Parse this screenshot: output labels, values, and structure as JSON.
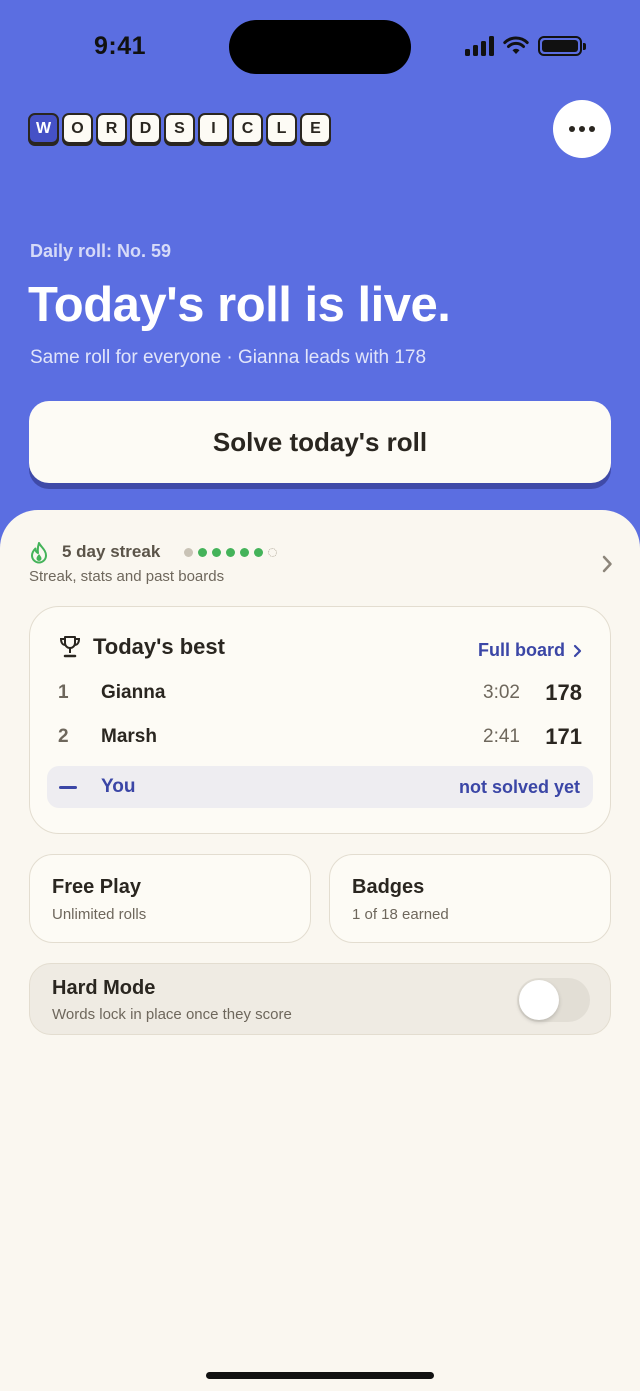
{
  "status_bar": {
    "time": "9:41"
  },
  "header": {
    "logo_letters": [
      "W",
      "O",
      "R",
      "D",
      "S",
      "I",
      "C",
      "L",
      "E"
    ],
    "menu_icon": "more-horizontal-icon"
  },
  "hero": {
    "daily_label": "Daily roll: No. 59",
    "headline": "Today's roll is live.",
    "subline": "Same roll for everyone · Gianna leads with 178",
    "cta_label": "Solve today's roll"
  },
  "streak": {
    "label": "5 day streak",
    "sub": "Streak, stats and past boards",
    "icon": "flame-icon"
  },
  "best": {
    "title": "Today's best",
    "link_label": "Full board",
    "rows": [
      {
        "rank": "1",
        "name": "Gianna",
        "time": "3:02",
        "score": "178"
      },
      {
        "rank": "2",
        "name": "Marsh",
        "time": "2:41",
        "score": "171"
      }
    ],
    "you": {
      "name": "You",
      "status": "not solved yet"
    }
  },
  "modes": {
    "free_play": {
      "title": "Free Play",
      "sub": "Unlimited rolls"
    },
    "badges": {
      "title": "Badges",
      "sub": "1 of 18 earned"
    }
  },
  "hard_mode": {
    "title": "Hard Mode",
    "sub": "Words lock in place once they score",
    "enabled": false
  },
  "colors": {
    "hero_bg": "#5b6ee1",
    "sheet_bg": "#faf7f0",
    "accent": "#3b46a6",
    "streak_green": "#44b35a"
  }
}
